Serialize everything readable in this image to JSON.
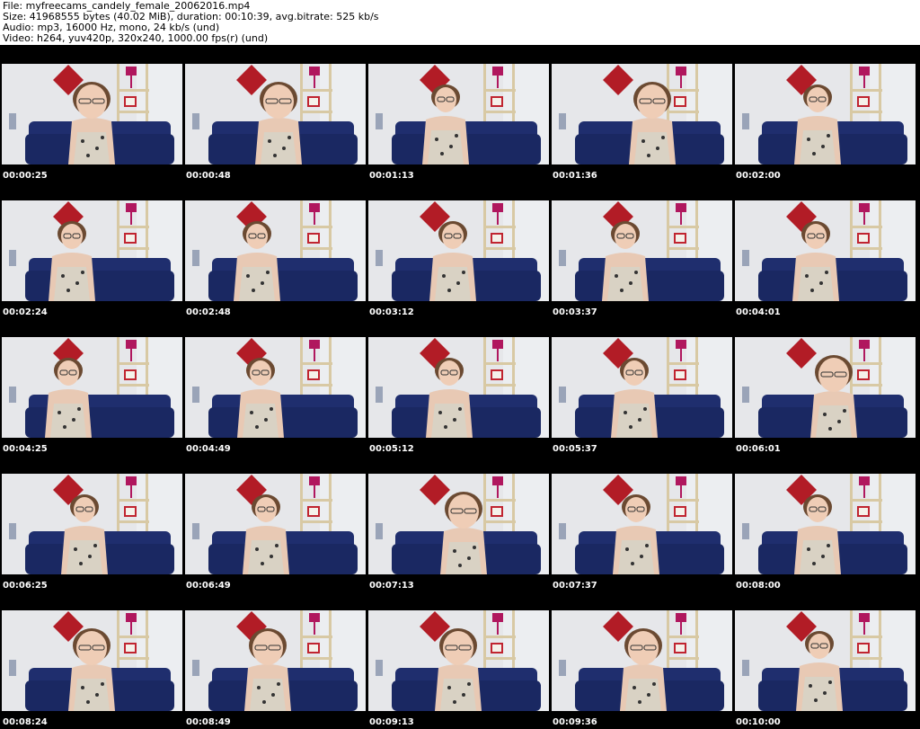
{
  "header": {
    "file_line": "File: myfreecams_candely_female_20062016.mp4",
    "size_line": "Size: 41968555 bytes (40.02 MiB), duration: 00:10:39, avg.bitrate: 525 kb/s",
    "audio_line": "Audio: mp3, 16000 Hz, mono, 24 kb/s (und)",
    "video_line": "Video: h264, yuv420p, 320x240, 1000.00 fps(r) (und)"
  },
  "thumbnails": [
    {
      "timestamp": "00:00:25"
    },
    {
      "timestamp": "00:00:48"
    },
    {
      "timestamp": "00:01:13"
    },
    {
      "timestamp": "00:01:36"
    },
    {
      "timestamp": "00:02:00"
    },
    {
      "timestamp": "00:02:24"
    },
    {
      "timestamp": "00:02:48"
    },
    {
      "timestamp": "00:03:12"
    },
    {
      "timestamp": "00:03:37"
    },
    {
      "timestamp": "00:04:01"
    },
    {
      "timestamp": "00:04:25"
    },
    {
      "timestamp": "00:04:49"
    },
    {
      "timestamp": "00:05:12"
    },
    {
      "timestamp": "00:05:37"
    },
    {
      "timestamp": "00:06:01"
    },
    {
      "timestamp": "00:06:25"
    },
    {
      "timestamp": "00:06:49"
    },
    {
      "timestamp": "00:07:13"
    },
    {
      "timestamp": "00:07:37"
    },
    {
      "timestamp": "00:08:00"
    },
    {
      "timestamp": "00:08:24"
    },
    {
      "timestamp": "00:08:49"
    },
    {
      "timestamp": "00:09:13"
    },
    {
      "timestamp": "00:09:36"
    },
    {
      "timestamp": "00:10:00"
    }
  ],
  "colors": {
    "sheet_background": "#000000",
    "header_background": "#ffffff",
    "timestamp_text": "#ffffff",
    "wall": "#e6e7ea",
    "sofa": "#1f2e6e",
    "lamp_shade": "#b0175e",
    "wall_art": "#b21c26"
  }
}
